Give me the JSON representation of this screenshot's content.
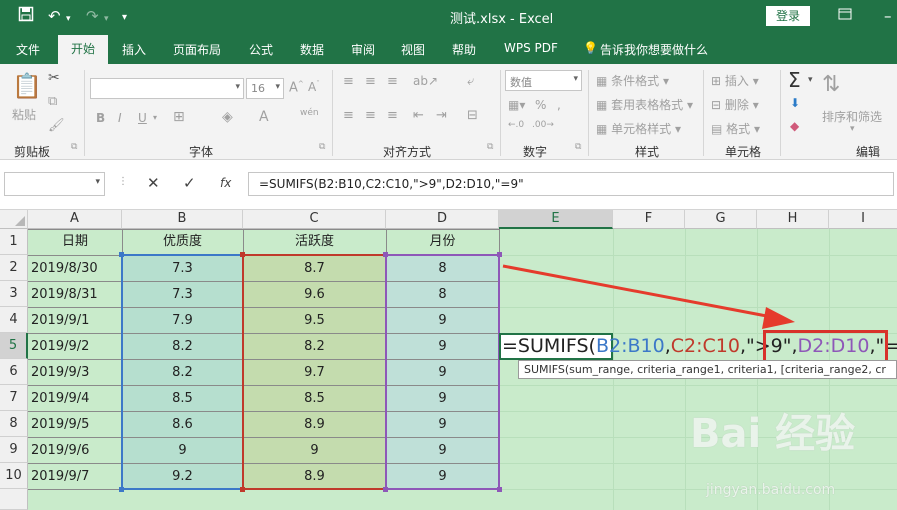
{
  "titlebar": {
    "title": "测试.xlsx  -  Excel",
    "login": "登录",
    "save_icon": "save-icon",
    "undo_icon": "undo-icon",
    "redo_icon": "redo-icon"
  },
  "ribbon_tabs": [
    "文件",
    "开始",
    "插入",
    "页面布局",
    "公式",
    "数据",
    "审阅",
    "视图",
    "帮助",
    "WPS PDF"
  ],
  "ribbon_tab_active": "开始",
  "tell_me": "告诉我你想要做什么",
  "ribbon": {
    "clipboard": {
      "label": "剪贴板",
      "paste": "粘贴"
    },
    "font": {
      "label": "字体",
      "size": "16",
      "wen": "wén"
    },
    "align": {
      "label": "对齐方式"
    },
    "number": {
      "label": "数字",
      "format": "数值"
    },
    "styles": {
      "label": "样式",
      "cond": "条件格式",
      "table": "套用表格格式",
      "cell": "单元格样式"
    },
    "cells": {
      "label": "单元格",
      "insert": "插入",
      "delete": "删除",
      "format": "格式"
    },
    "edit": {
      "label": "编辑",
      "sort": "排序和筛选"
    }
  },
  "formula_bar": {
    "name_box": "",
    "content": "=SUMIFS(B2:B10,C2:C10,\">9\",D2:D10,\"=9\"",
    "fx": "fx"
  },
  "columns": [
    "A",
    "B",
    "C",
    "D",
    "E",
    "F",
    "G",
    "H",
    "I"
  ],
  "selected_column": "E",
  "rows": [
    "1",
    "2",
    "3",
    "4",
    "5",
    "6",
    "7",
    "8",
    "9",
    "10"
  ],
  "selected_row": "5",
  "sheet": {
    "headers": [
      "日期",
      "优质度",
      "活跃度",
      "月份"
    ],
    "data": [
      [
        "2019/8/30",
        "7.3",
        "8.7",
        "8"
      ],
      [
        "2019/8/31",
        "7.3",
        "9.6",
        "8"
      ],
      [
        "2019/9/1",
        "7.9",
        "9.5",
        "9"
      ],
      [
        "2019/9/2",
        "8.2",
        "8.2",
        "9"
      ],
      [
        "2019/9/3",
        "8.2",
        "9.7",
        "9"
      ],
      [
        "2019/9/4",
        "8.5",
        "8.5",
        "9"
      ],
      [
        "2019/9/5",
        "8.6",
        "8.9",
        "9"
      ],
      [
        "2019/9/6",
        "9",
        "9",
        "9"
      ],
      [
        "2019/9/7",
        "9.2",
        "8.9",
        "9"
      ]
    ]
  },
  "editing_cell": {
    "p1": "=SUMIFS(",
    "p2": "B2:B10",
    "p3": ",",
    "p4": "C2:C10",
    "p5": ",\">9\"",
    "p6": ",",
    "p7": "D2:D10",
    "p8": ",\"=9\""
  },
  "tooltip": "SUMIFS(sum_range, criteria_range1, criteria1, [criteria_range2, cr",
  "watermark": {
    "logo": "Bai 经验",
    "url": "jingyan.baidu.com"
  },
  "colors": {
    "excel_green": "#217346",
    "range_blue": "#3c78c8",
    "range_red": "#c0392b",
    "range_purple": "#8e57b8",
    "arrow_red": "#e53b2c"
  }
}
